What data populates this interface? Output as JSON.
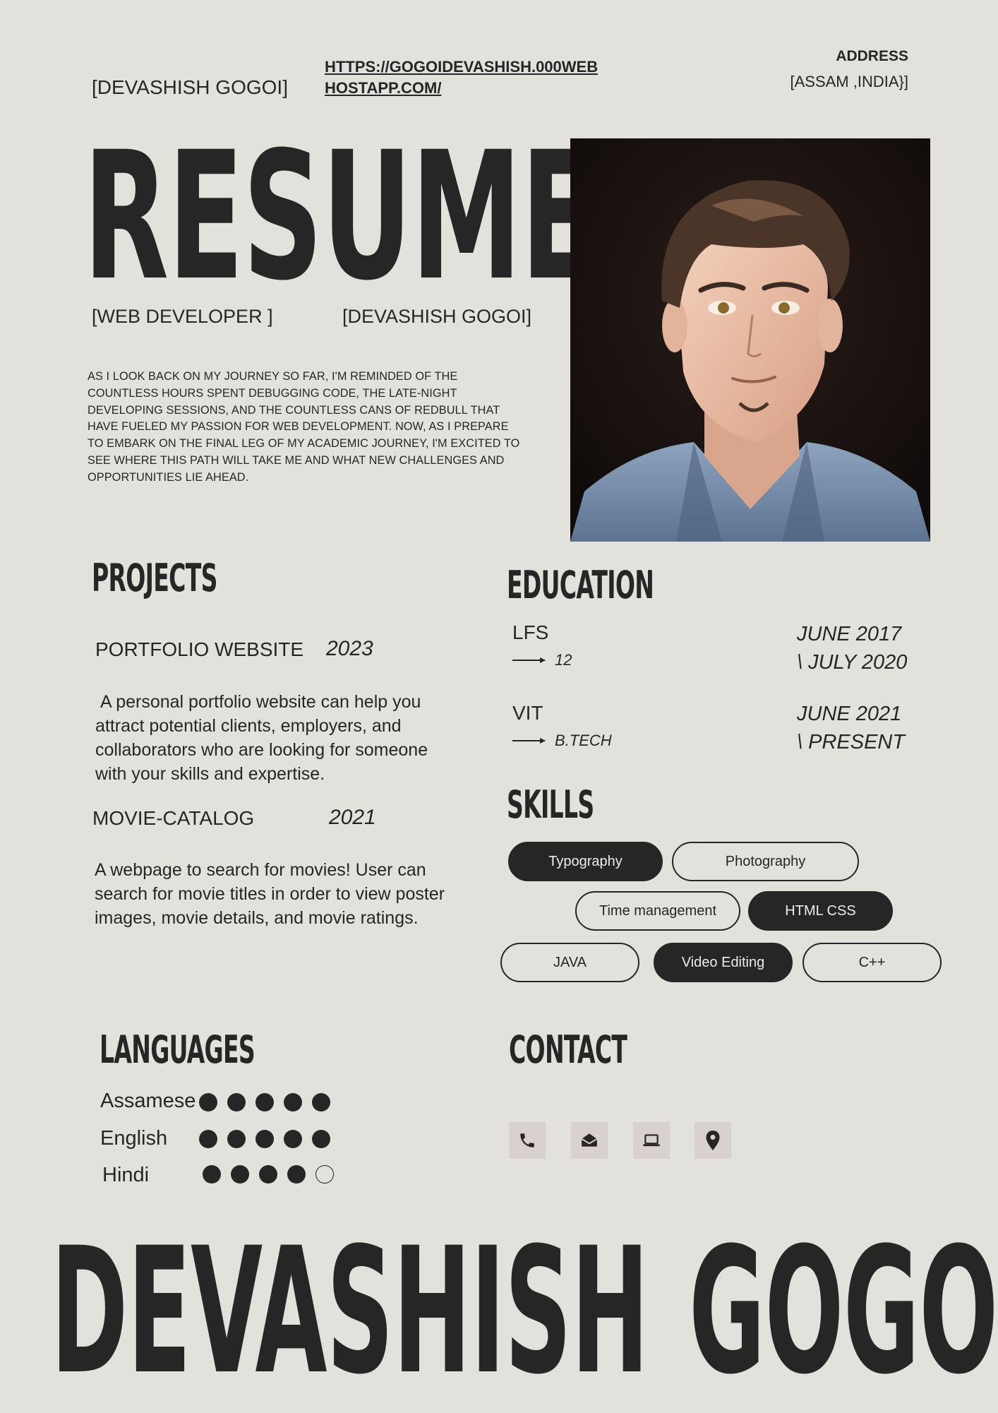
{
  "header": {
    "name": "[DEVASHISH GOGOI]",
    "website": "HTTPS://GOGOIDEVASHISH.000WEBHOSTAPP.COM/",
    "address_label": "ADDRESS",
    "address_value": "[ASSAM ,INDIA}]"
  },
  "hero": {
    "title": "RESUME",
    "role": "[WEB DEVELOPER ]",
    "name": "[DEVASHISH GOGOI]",
    "intro": "AS I LOOK BACK ON MY JOURNEY SO FAR, I'M REMINDED OF THE COUNTLESS HOURS SPENT DEBUGGING CODE, THE LATE-NIGHT DEVELOPING SESSIONS, AND THE COUNTLESS CANS OF REDBULL THAT HAVE FUELED MY PASSION FOR WEB DEVELOPMENT. NOW, AS I PREPARE TO EMBARK ON THE FINAL LEG OF MY ACADEMIC JOURNEY, I'M EXCITED TO SEE WHERE THIS PATH WILL TAKE ME AND WHAT NEW CHALLENGES AND OPPORTUNITIES LIE AHEAD."
  },
  "projects": {
    "title": "PROJECTS",
    "items": [
      {
        "name": "PORTFOLIO WEBSITE",
        "year": "2023",
        "description": " A personal portfolio website can help you attract potential clients, employers, and collaborators who are looking for someone with your skills and expertise."
      },
      {
        "name": "MOVIE-CATALOG",
        "year": "2021",
        "description": "A webpage to search for movies! User can search for movie titles in order to view poster images, movie details, and movie ratings."
      }
    ]
  },
  "education": {
    "title": "EDUCATION",
    "items": [
      {
        "school": "LFS",
        "level": "12",
        "date_start": "JUNE 2017",
        "date_end": "\\ JULY 2020"
      },
      {
        "school": "VIT",
        "level": "B.TECH",
        "date_start": "JUNE 2021",
        "date_end": "\\ PRESENT"
      }
    ]
  },
  "skills": {
    "title": "SKILLS",
    "items": [
      {
        "label": "Typography",
        "style": "dark"
      },
      {
        "label": "Photography",
        "style": "outline"
      },
      {
        "label": "Time management",
        "style": "outline"
      },
      {
        "label": "HTML CSS",
        "style": "dark"
      },
      {
        "label": "JAVA",
        "style": "outline"
      },
      {
        "label": "Video Editing",
        "style": "dark"
      },
      {
        "label": "C++",
        "style": "outline"
      }
    ]
  },
  "languages": {
    "title": "LANGUAGES",
    "items": [
      {
        "name": "Assamese",
        "level": 5,
        "max": 5
      },
      {
        "name": "English",
        "level": 5,
        "max": 5
      },
      {
        "name": "Hindi",
        "level": 4,
        "max": 5
      }
    ]
  },
  "contact": {
    "title": "CONTACT",
    "icons": [
      "phone-icon",
      "email-icon",
      "laptop-icon",
      "location-pin-icon"
    ]
  },
  "footer": {
    "name": "DEVASHISH GOGOI"
  },
  "colors": {
    "background": "#e2e1dc",
    "text": "#262626",
    "icon_tile": "#d9d1cd"
  }
}
